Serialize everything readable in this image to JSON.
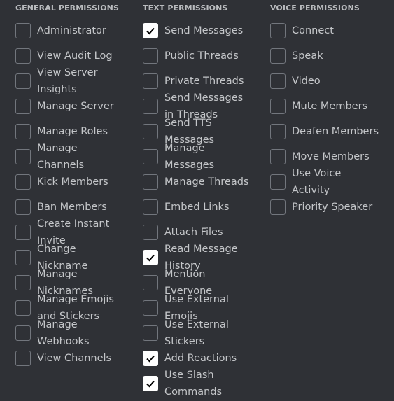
{
  "columns": [
    {
      "title": "GENERAL PERMISSIONS",
      "items": [
        {
          "label": "Administrator",
          "checked": false
        },
        {
          "label": "View Audit Log",
          "checked": false
        },
        {
          "label": "View Server Insights",
          "checked": false
        },
        {
          "label": "Manage Server",
          "checked": false
        },
        {
          "label": "Manage Roles",
          "checked": false
        },
        {
          "label": "Manage Channels",
          "checked": false
        },
        {
          "label": "Kick Members",
          "checked": false
        },
        {
          "label": "Ban Members",
          "checked": false
        },
        {
          "label": "Create Instant Invite",
          "checked": false
        },
        {
          "label": "Change Nickname",
          "checked": false
        },
        {
          "label": "Manage Nicknames",
          "checked": false
        },
        {
          "label": "Manage Emojis and Stickers",
          "checked": false
        },
        {
          "label": "Manage Webhooks",
          "checked": false
        },
        {
          "label": "View Channels",
          "checked": false
        }
      ]
    },
    {
      "title": "TEXT PERMISSIONS",
      "items": [
        {
          "label": "Send Messages",
          "checked": true
        },
        {
          "label": "Public Threads",
          "checked": false
        },
        {
          "label": "Private Threads",
          "checked": false
        },
        {
          "label": "Send Messages in Threads",
          "checked": false
        },
        {
          "label": "Send TTS Messages",
          "checked": false
        },
        {
          "label": "Manage Messages",
          "checked": false
        },
        {
          "label": "Manage Threads",
          "checked": false
        },
        {
          "label": "Embed Links",
          "checked": false
        },
        {
          "label": "Attach Files",
          "checked": false
        },
        {
          "label": "Read Message History",
          "checked": true
        },
        {
          "label": "Mention Everyone",
          "checked": false
        },
        {
          "label": "Use External Emojis",
          "checked": false
        },
        {
          "label": "Use External Stickers",
          "checked": false
        },
        {
          "label": "Add Reactions",
          "checked": true
        },
        {
          "label": "Use Slash Commands",
          "checked": true
        }
      ]
    },
    {
      "title": "VOICE PERMISSIONS",
      "items": [
        {
          "label": "Connect",
          "checked": false
        },
        {
          "label": "Speak",
          "checked": false
        },
        {
          "label": "Video",
          "checked": false
        },
        {
          "label": "Mute Members",
          "checked": false
        },
        {
          "label": "Deafen Members",
          "checked": false
        },
        {
          "label": "Move Members",
          "checked": false
        },
        {
          "label": "Use Voice Activity",
          "checked": false
        },
        {
          "label": "Priority Speaker",
          "checked": false
        }
      ]
    }
  ]
}
